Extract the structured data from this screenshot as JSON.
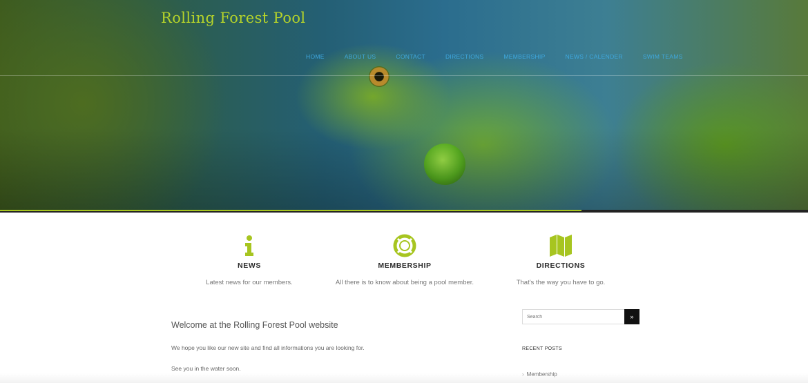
{
  "site": {
    "title": "Rolling Forest Pool"
  },
  "nav": {
    "items": [
      {
        "label": "Home"
      },
      {
        "label": "About us"
      },
      {
        "label": "Contact"
      },
      {
        "label": "Directions"
      },
      {
        "label": "Membership"
      },
      {
        "label": "News / Calender"
      },
      {
        "label": "Swim Teams"
      }
    ]
  },
  "colors": {
    "accent": "#a7c520",
    "nav_link": "#3fa9e0",
    "title": "#b5d32a"
  },
  "hero": {
    "slider_progress": 0.72
  },
  "features": [
    {
      "icon": "info-icon",
      "title": "NEWS",
      "desc": "Latest news for our members."
    },
    {
      "icon": "lifebuoy-icon",
      "title": "MEMBERSHIP",
      "desc": "All there is to know about being a pool member."
    },
    {
      "icon": "map-icon",
      "title": "DIRECTIONS",
      "desc": "That's the way you have to go."
    }
  ],
  "main": {
    "title": "Welcome at the Rolling Forest Pool website",
    "para1": "We hope you like our new site and find all informations you are looking for.",
    "para2": "See you in the water soon."
  },
  "sidebar": {
    "search_placeholder": "Search",
    "search_button": "»",
    "recent_title": "RECENT POSTS",
    "posts": [
      {
        "label": "Membership"
      }
    ]
  }
}
